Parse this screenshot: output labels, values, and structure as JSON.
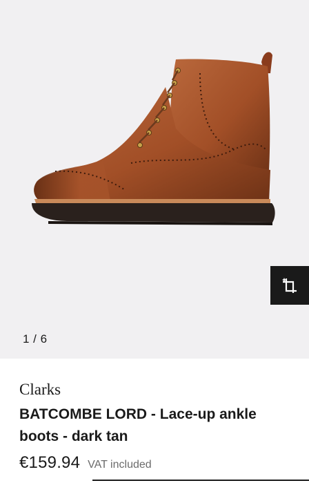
{
  "gallery": {
    "counter": "1 / 6",
    "image_icon": "brown-leather-brogue-boot",
    "try_on_icon": "sparkle-crop-icon"
  },
  "product": {
    "brand": "Clarks",
    "name": "BATCOMBE LORD - Lace-up ankle boots - dark tan",
    "price": "€159.94",
    "vat_note": "VAT included"
  },
  "colors": {
    "gallery_bg": "#f1f0f2",
    "boot_leather": "#a4522a",
    "boot_sole": "#2a211d",
    "button_bg": "#1a1a1a"
  }
}
